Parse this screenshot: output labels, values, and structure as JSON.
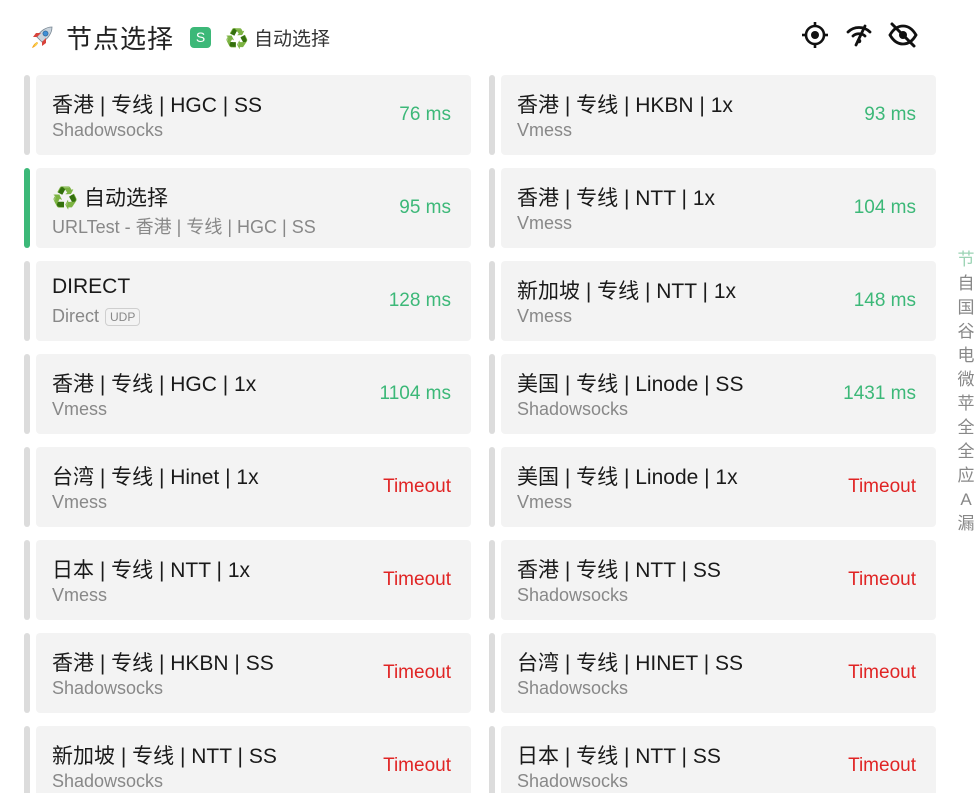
{
  "header": {
    "title": "节点选择",
    "badge": "S",
    "current_selection": "♻️ 自动选择"
  },
  "toolbar": {
    "icons": [
      "locate-icon",
      "wifi-off-icon",
      "eye-off-icon"
    ]
  },
  "colors": {
    "ok": "#3cb878",
    "bad": "#e02424",
    "active_bar": "#3cb878",
    "inactive_bar": "#dcdcdc",
    "card_bg": "#f3f3f3"
  },
  "proxies": [
    {
      "name": "香港 | 专线 | HGC | SS",
      "type": "Shadowsocks",
      "latency": "76 ms",
      "status": "ok"
    },
    {
      "name": "香港 | 专线 | HKBN | 1x",
      "type": "Vmess",
      "latency": "93 ms",
      "status": "ok"
    },
    {
      "name": "♻️ 自动选择",
      "type": "URLTest - 香港 | 专线 | HGC | SS",
      "latency": "95 ms",
      "status": "ok",
      "active": true
    },
    {
      "name": "香港 | 专线 | NTT | 1x",
      "type": "Vmess",
      "latency": "104 ms",
      "status": "ok"
    },
    {
      "name": "DIRECT",
      "type": "Direct",
      "tag": "UDP",
      "latency": "128 ms",
      "status": "ok"
    },
    {
      "name": "新加坡 | 专线 | NTT | 1x",
      "type": "Vmess",
      "latency": "148 ms",
      "status": "ok"
    },
    {
      "name": "香港 | 专线 | HGC | 1x",
      "type": "Vmess",
      "latency": "1104 ms",
      "status": "ok"
    },
    {
      "name": "美国 | 专线 | Linode | SS",
      "type": "Shadowsocks",
      "latency": "1431 ms",
      "status": "ok"
    },
    {
      "name": "台湾 | 专线 | Hinet | 1x",
      "type": "Vmess",
      "latency": "Timeout",
      "status": "bad"
    },
    {
      "name": "美国 | 专线 | Linode | 1x",
      "type": "Vmess",
      "latency": "Timeout",
      "status": "bad"
    },
    {
      "name": "日本 | 专线 | NTT | 1x",
      "type": "Vmess",
      "latency": "Timeout",
      "status": "bad"
    },
    {
      "name": "香港 | 专线 | NTT | SS",
      "type": "Shadowsocks",
      "latency": "Timeout",
      "status": "bad"
    },
    {
      "name": "香港 | 专线 | HKBN | SS",
      "type": "Shadowsocks",
      "latency": "Timeout",
      "status": "bad"
    },
    {
      "name": "台湾 | 专线 | HINET | SS",
      "type": "Shadowsocks",
      "latency": "Timeout",
      "status": "bad"
    },
    {
      "name": "新加坡 | 专线 | NTT | SS",
      "type": "Shadowsocks",
      "latency": "Timeout",
      "status": "bad"
    },
    {
      "name": "日本 | 专线 | NTT | SS",
      "type": "Shadowsocks",
      "latency": "Timeout",
      "status": "bad"
    }
  ],
  "side_index": [
    "节",
    "自",
    "国",
    "谷",
    "电",
    "微",
    "苹",
    "全",
    "全",
    "应",
    "A",
    "漏"
  ]
}
